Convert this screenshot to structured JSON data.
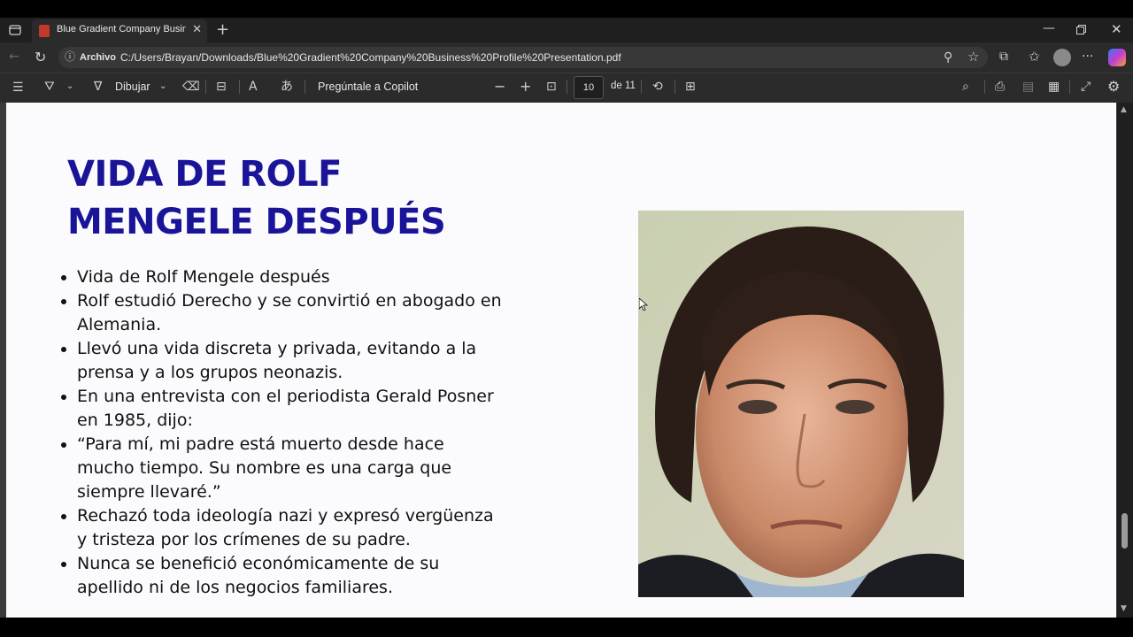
{
  "browser": {
    "tab_title": "Blue Gradient Company Business Profile Presentation.pdf",
    "address_site_label": "Archivo",
    "url": "C:/Users/Brayan/Downloads/Blue%20Gradient%20Company%20Business%20Profile%20Presentation.pdf"
  },
  "pdf_toolbar": {
    "draw_label": "Dibujar",
    "copilot_label": "Pregúntale a Copilot",
    "page_number": "10",
    "page_total": "de 11"
  },
  "slide": {
    "title_line1": "VIDA DE ROLF",
    "title_line2": "MENGELE DESPUÉS",
    "bullets": [
      "Vida de Rolf Mengele después",
      "Rolf estudió Derecho y se convirtió en abogado en Alemania.",
      "Llevó una vida discreta y privada, evitando a la prensa y a los grupos neonazis.",
      "En una entrevista con el periodista Gerald Posner en 1985, dijo:",
      "“Para mí, mi padre está muerto desde hace mucho tiempo. Su nombre es una carga que siempre llevaré.”",
      "Rechazó toda ideología nazi y expresó vergüenza y tristeza por los crímenes de su padre.",
      "Nunca se benefició económicamente de su apellido ni de los negocios familiares."
    ]
  },
  "colors": {
    "title": "#1a1499",
    "chrome_bg": "#2b2b2b",
    "page_bg": "#fbfbfd"
  }
}
